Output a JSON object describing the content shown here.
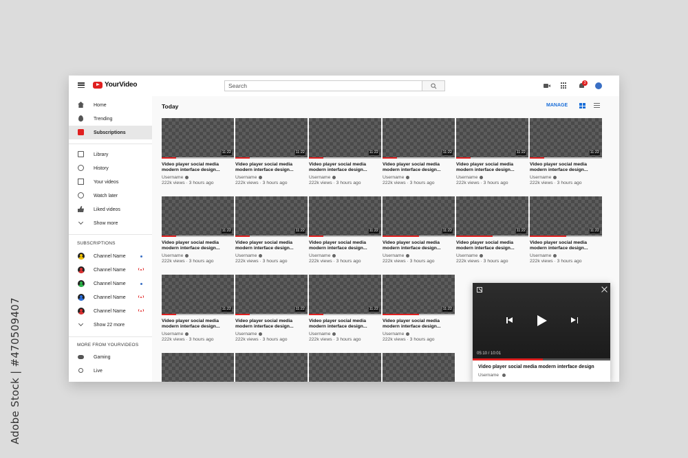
{
  "stock_caption": "Adobe Stock | #470509407",
  "header": {
    "logo_text": "YourVideo",
    "search_placeholder": "Search",
    "notification_count": "3"
  },
  "sidebar": {
    "main_items": [
      {
        "label": "Home",
        "icon": "home-icon"
      },
      {
        "label": "Trending",
        "icon": "fire-icon"
      },
      {
        "label": "Subscriptions",
        "icon": "subscriptions-icon",
        "active": true
      }
    ],
    "library_items": [
      {
        "label": "Library",
        "icon": "library-icon"
      },
      {
        "label": "History",
        "icon": "history-icon"
      },
      {
        "label": "Your videos",
        "icon": "your-videos-icon"
      },
      {
        "label": "Watch later",
        "icon": "clock-icon"
      },
      {
        "label": "Liked videos",
        "icon": "thumbs-up-icon"
      },
      {
        "label": "Show more",
        "icon": "chevron-down-icon"
      }
    ],
    "subscriptions_title": "SUBSCRIPTIONS",
    "channels": [
      {
        "label": "Channel Name",
        "color": "#f2c200",
        "status": "new"
      },
      {
        "label": "Channel Name",
        "color": "#e03030",
        "status": "live"
      },
      {
        "label": "Channel Name",
        "color": "#2cb84a",
        "status": "new"
      },
      {
        "label": "Channel Name",
        "color": "#2a6fe0",
        "status": "live"
      },
      {
        "label": "Channel Name",
        "color": "#e03030",
        "status": "live"
      }
    ],
    "show_more_channels": "Show 22 more",
    "more_title": "MORE FROM YOURVIDEOS",
    "more_items": [
      {
        "label": "Gaming",
        "icon": "gamepad-icon"
      },
      {
        "label": "Live",
        "icon": "live-icon"
      }
    ]
  },
  "main": {
    "section_title": "Today",
    "manage_label": "MANAGE",
    "video": {
      "title": "Video player social media modern interface design...",
      "username": "Username",
      "meta": "222k views · 3 hours ago",
      "duration": "11:22"
    },
    "watch_progress": [
      [
        0.2,
        0.2,
        0.2,
        0.2,
        0.2,
        0.2
      ],
      [
        0.2,
        0.2,
        0.2,
        0.5,
        0.5,
        0.5
      ],
      [
        0.2,
        0.2,
        0.2,
        0.5,
        0.2,
        0.2
      ]
    ]
  },
  "mini_player": {
    "time": "05:10 / 10:01",
    "progress": 0.51,
    "title": "Video player social media modern interface design",
    "username": "Username"
  }
}
